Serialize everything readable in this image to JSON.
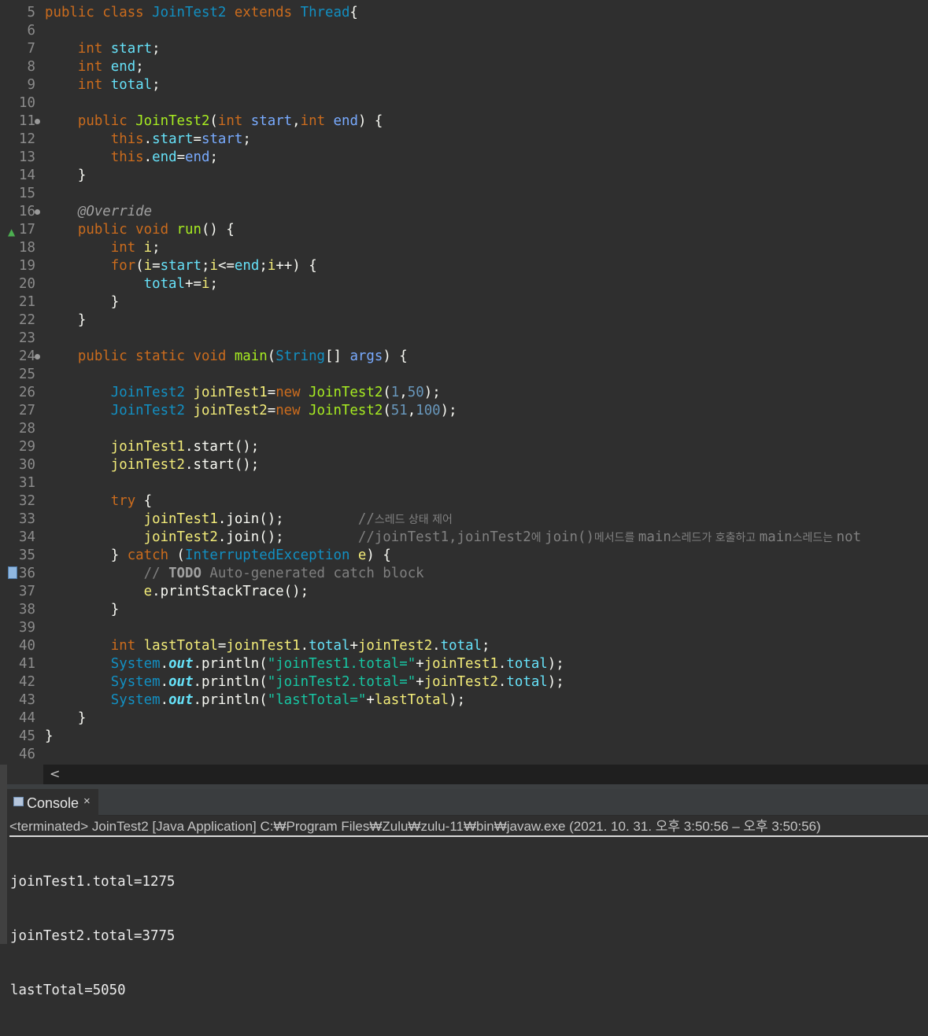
{
  "editor": {
    "lines": [
      {
        "n": "5",
        "t": [
          [
            "kw",
            "public class "
          ],
          [
            "ty",
            "JoinTest2"
          ],
          [
            "kw",
            " extends "
          ],
          [
            "ty",
            "Thread"
          ],
          [
            "pt",
            "{"
          ]
        ]
      },
      {
        "n": "6",
        "t": []
      },
      {
        "n": "7",
        "t": [
          [
            "pt",
            "    "
          ],
          [
            "kw",
            "int "
          ],
          [
            "fd",
            "start"
          ],
          [
            "pt",
            ";"
          ]
        ]
      },
      {
        "n": "8",
        "t": [
          [
            "pt",
            "    "
          ],
          [
            "kw",
            "int "
          ],
          [
            "fd",
            "end"
          ],
          [
            "pt",
            ";"
          ]
        ]
      },
      {
        "n": "9",
        "t": [
          [
            "pt",
            "    "
          ],
          [
            "kw",
            "int "
          ],
          [
            "fd",
            "total"
          ],
          [
            "pt",
            ";"
          ]
        ]
      },
      {
        "n": "10",
        "t": []
      },
      {
        "n": "11",
        "m": "fold",
        "t": [
          [
            "pt",
            "    "
          ],
          [
            "kw",
            "public "
          ],
          [
            "md",
            "JoinTest2"
          ],
          [
            "pt",
            "("
          ],
          [
            "kw",
            "int "
          ],
          [
            "pr",
            "start"
          ],
          [
            "pt",
            ","
          ],
          [
            "kw",
            "int "
          ],
          [
            "pr",
            "end"
          ],
          [
            "pt",
            ") {"
          ]
        ]
      },
      {
        "n": "12",
        "t": [
          [
            "pt",
            "        "
          ],
          [
            "kw",
            "this"
          ],
          [
            "pt",
            "."
          ],
          [
            "fd",
            "start"
          ],
          [
            "pt",
            "="
          ],
          [
            "pr",
            "start"
          ],
          [
            "pt",
            ";"
          ]
        ]
      },
      {
        "n": "13",
        "t": [
          [
            "pt",
            "        "
          ],
          [
            "kw",
            "this"
          ],
          [
            "pt",
            "."
          ],
          [
            "fd",
            "end"
          ],
          [
            "pt",
            "="
          ],
          [
            "pr",
            "end"
          ],
          [
            "pt",
            ";"
          ]
        ]
      },
      {
        "n": "14",
        "t": [
          [
            "pt",
            "    }"
          ]
        ]
      },
      {
        "n": "15",
        "t": []
      },
      {
        "n": "16",
        "m": "fold",
        "t": [
          [
            "pt",
            "    "
          ],
          [
            "an",
            "@Override"
          ]
        ]
      },
      {
        "n": "17",
        "m": "override",
        "t": [
          [
            "pt",
            "    "
          ],
          [
            "kw",
            "public void "
          ],
          [
            "md",
            "run"
          ],
          [
            "pt",
            "() {"
          ]
        ]
      },
      {
        "n": "18",
        "t": [
          [
            "pt",
            "        "
          ],
          [
            "kw",
            "int "
          ],
          [
            "lv",
            "i"
          ],
          [
            "pt",
            ";"
          ]
        ]
      },
      {
        "n": "19",
        "t": [
          [
            "pt",
            "        "
          ],
          [
            "kw",
            "for"
          ],
          [
            "pt",
            "("
          ],
          [
            "lv",
            "i"
          ],
          [
            "pt",
            "="
          ],
          [
            "fd",
            "start"
          ],
          [
            "pt",
            ";"
          ],
          [
            "lv",
            "i"
          ],
          [
            "pt",
            "<="
          ],
          [
            "fd",
            "end"
          ],
          [
            "pt",
            ";"
          ],
          [
            "lv",
            "i"
          ],
          [
            "pt",
            "++) {"
          ]
        ]
      },
      {
        "n": "20",
        "t": [
          [
            "pt",
            "            "
          ],
          [
            "fd",
            "total"
          ],
          [
            "pt",
            "+="
          ],
          [
            "lv",
            "i"
          ],
          [
            "pt",
            ";"
          ]
        ]
      },
      {
        "n": "21",
        "t": [
          [
            "pt",
            "        }"
          ]
        ]
      },
      {
        "n": "22",
        "t": [
          [
            "pt",
            "    }"
          ]
        ]
      },
      {
        "n": "23",
        "t": []
      },
      {
        "n": "24",
        "m": "fold",
        "t": [
          [
            "pt",
            "    "
          ],
          [
            "kw",
            "public static void "
          ],
          [
            "md",
            "main"
          ],
          [
            "pt",
            "("
          ],
          [
            "ty",
            "String"
          ],
          [
            "pt",
            "[] "
          ],
          [
            "pr",
            "args"
          ],
          [
            "pt",
            ") {"
          ]
        ]
      },
      {
        "n": "25",
        "t": []
      },
      {
        "n": "26",
        "t": [
          [
            "pt",
            "        "
          ],
          [
            "ty",
            "JoinTest2 "
          ],
          [
            "lv",
            "joinTest1"
          ],
          [
            "pt",
            "="
          ],
          [
            "kw",
            "new "
          ],
          [
            "md",
            "JoinTest2"
          ],
          [
            "pt",
            "("
          ],
          [
            "nm",
            "1"
          ],
          [
            "pt",
            ","
          ],
          [
            "nm",
            "50"
          ],
          [
            "pt",
            ");"
          ]
        ]
      },
      {
        "n": "27",
        "t": [
          [
            "pt",
            "        "
          ],
          [
            "ty",
            "JoinTest2 "
          ],
          [
            "lv",
            "joinTest2"
          ],
          [
            "pt",
            "="
          ],
          [
            "kw",
            "new "
          ],
          [
            "md",
            "JoinTest2"
          ],
          [
            "pt",
            "("
          ],
          [
            "nm",
            "51"
          ],
          [
            "pt",
            ","
          ],
          [
            "nm",
            "100"
          ],
          [
            "pt",
            ");"
          ]
        ]
      },
      {
        "n": "28",
        "t": []
      },
      {
        "n": "29",
        "t": [
          [
            "pt",
            "        "
          ],
          [
            "lv",
            "joinTest1"
          ],
          [
            "pt",
            ".start();"
          ]
        ]
      },
      {
        "n": "30",
        "t": [
          [
            "pt",
            "        "
          ],
          [
            "lv",
            "joinTest2"
          ],
          [
            "pt",
            ".start();"
          ]
        ]
      },
      {
        "n": "31",
        "t": []
      },
      {
        "n": "32",
        "t": [
          [
            "pt",
            "        "
          ],
          [
            "kw",
            "try "
          ],
          [
            "pt",
            "{"
          ]
        ]
      },
      {
        "n": "33",
        "t": [
          [
            "pt",
            "            "
          ],
          [
            "lv",
            "joinTest1"
          ],
          [
            "pt",
            ".join();         "
          ],
          [
            "cm",
            "//"
          ],
          [
            "ko",
            "스레드 상태 제어"
          ]
        ]
      },
      {
        "n": "34",
        "t": [
          [
            "pt",
            "            "
          ],
          [
            "lv",
            "joinTest2"
          ],
          [
            "pt",
            ".join();         "
          ],
          [
            "cm",
            "//joinTest1,joinTest2"
          ],
          [
            "ko",
            "에 "
          ],
          [
            "cm",
            "join()"
          ],
          [
            "ko",
            "메서드를 "
          ],
          [
            "cm",
            "main"
          ],
          [
            "ko",
            "스레드가 호출하고 "
          ],
          [
            "cm",
            "main"
          ],
          [
            "ko",
            "스레드는 "
          ],
          [
            "cm",
            "not"
          ]
        ]
      },
      {
        "n": "35",
        "t": [
          [
            "pt",
            "        } "
          ],
          [
            "kw",
            "catch "
          ],
          [
            "pt",
            "("
          ],
          [
            "ty",
            "InterruptedException "
          ],
          [
            "lv",
            "e"
          ],
          [
            "pt",
            ") {"
          ]
        ]
      },
      {
        "n": "36",
        "m": "task",
        "t": [
          [
            "pt",
            "            "
          ],
          [
            "cm",
            "// "
          ],
          [
            "cmb",
            "TODO"
          ],
          [
            "cm",
            " Auto-generated catch block"
          ]
        ]
      },
      {
        "n": "37",
        "t": [
          [
            "pt",
            "            "
          ],
          [
            "lv",
            "e"
          ],
          [
            "pt",
            ".printStackTrace();"
          ]
        ]
      },
      {
        "n": "38",
        "t": [
          [
            "pt",
            "        }"
          ]
        ]
      },
      {
        "n": "39",
        "t": []
      },
      {
        "n": "40",
        "t": [
          [
            "pt",
            "        "
          ],
          [
            "kw",
            "int "
          ],
          [
            "lv",
            "lastTotal"
          ],
          [
            "pt",
            "="
          ],
          [
            "lv",
            "joinTest1"
          ],
          [
            "pt",
            "."
          ],
          [
            "fd",
            "total"
          ],
          [
            "pt",
            "+"
          ],
          [
            "lv",
            "joinTest2"
          ],
          [
            "pt",
            "."
          ],
          [
            "fd",
            "total"
          ],
          [
            "pt",
            ";"
          ]
        ]
      },
      {
        "n": "41",
        "t": [
          [
            "pt",
            "        "
          ],
          [
            "ty",
            "System"
          ],
          [
            "pt",
            "."
          ],
          [
            "so",
            "out"
          ],
          [
            "pt",
            ".println("
          ],
          [
            "st",
            "\"joinTest1.total=\""
          ],
          [
            "pt",
            "+"
          ],
          [
            "lv",
            "joinTest1"
          ],
          [
            "pt",
            "."
          ],
          [
            "fd",
            "total"
          ],
          [
            "pt",
            ");"
          ]
        ]
      },
      {
        "n": "42",
        "t": [
          [
            "pt",
            "        "
          ],
          [
            "ty",
            "System"
          ],
          [
            "pt",
            "."
          ],
          [
            "so",
            "out"
          ],
          [
            "pt",
            ".println("
          ],
          [
            "st",
            "\"joinTest2.total=\""
          ],
          [
            "pt",
            "+"
          ],
          [
            "lv",
            "joinTest2"
          ],
          [
            "pt",
            "."
          ],
          [
            "fd",
            "total"
          ],
          [
            "pt",
            ");"
          ]
        ]
      },
      {
        "n": "43",
        "t": [
          [
            "pt",
            "        "
          ],
          [
            "ty",
            "System"
          ],
          [
            "pt",
            "."
          ],
          [
            "so",
            "out"
          ],
          [
            "pt",
            ".println("
          ],
          [
            "st",
            "\"lastTotal=\""
          ],
          [
            "pt",
            "+"
          ],
          [
            "lv",
            "lastTotal"
          ],
          [
            "pt",
            ");"
          ]
        ]
      },
      {
        "n": "44",
        "t": [
          [
            "pt",
            "    }"
          ]
        ]
      },
      {
        "n": "45",
        "t": [
          [
            "pt",
            "}"
          ]
        ]
      },
      {
        "n": "46",
        "t": []
      }
    ]
  },
  "scrollbar": {
    "left_arrow": "<"
  },
  "console": {
    "tab_label": "Console",
    "close_glyph": "×",
    "status": "<terminated> JoinTest2 [Java Application] C:₩Program Files₩Zulu₩zulu-11₩bin₩javaw.exe  (2021. 10. 31. 오후 3:50:56 – 오후 3:50:56)",
    "output": [
      "joinTest1.total=1275",
      "joinTest2.total=3775",
      "lastTotal=5050"
    ]
  },
  "icons": {
    "fold_marker": "fold-icon",
    "override_marker": "override-triangle-icon",
    "task_marker": "task-icon",
    "console_view": "console-view-icon"
  }
}
